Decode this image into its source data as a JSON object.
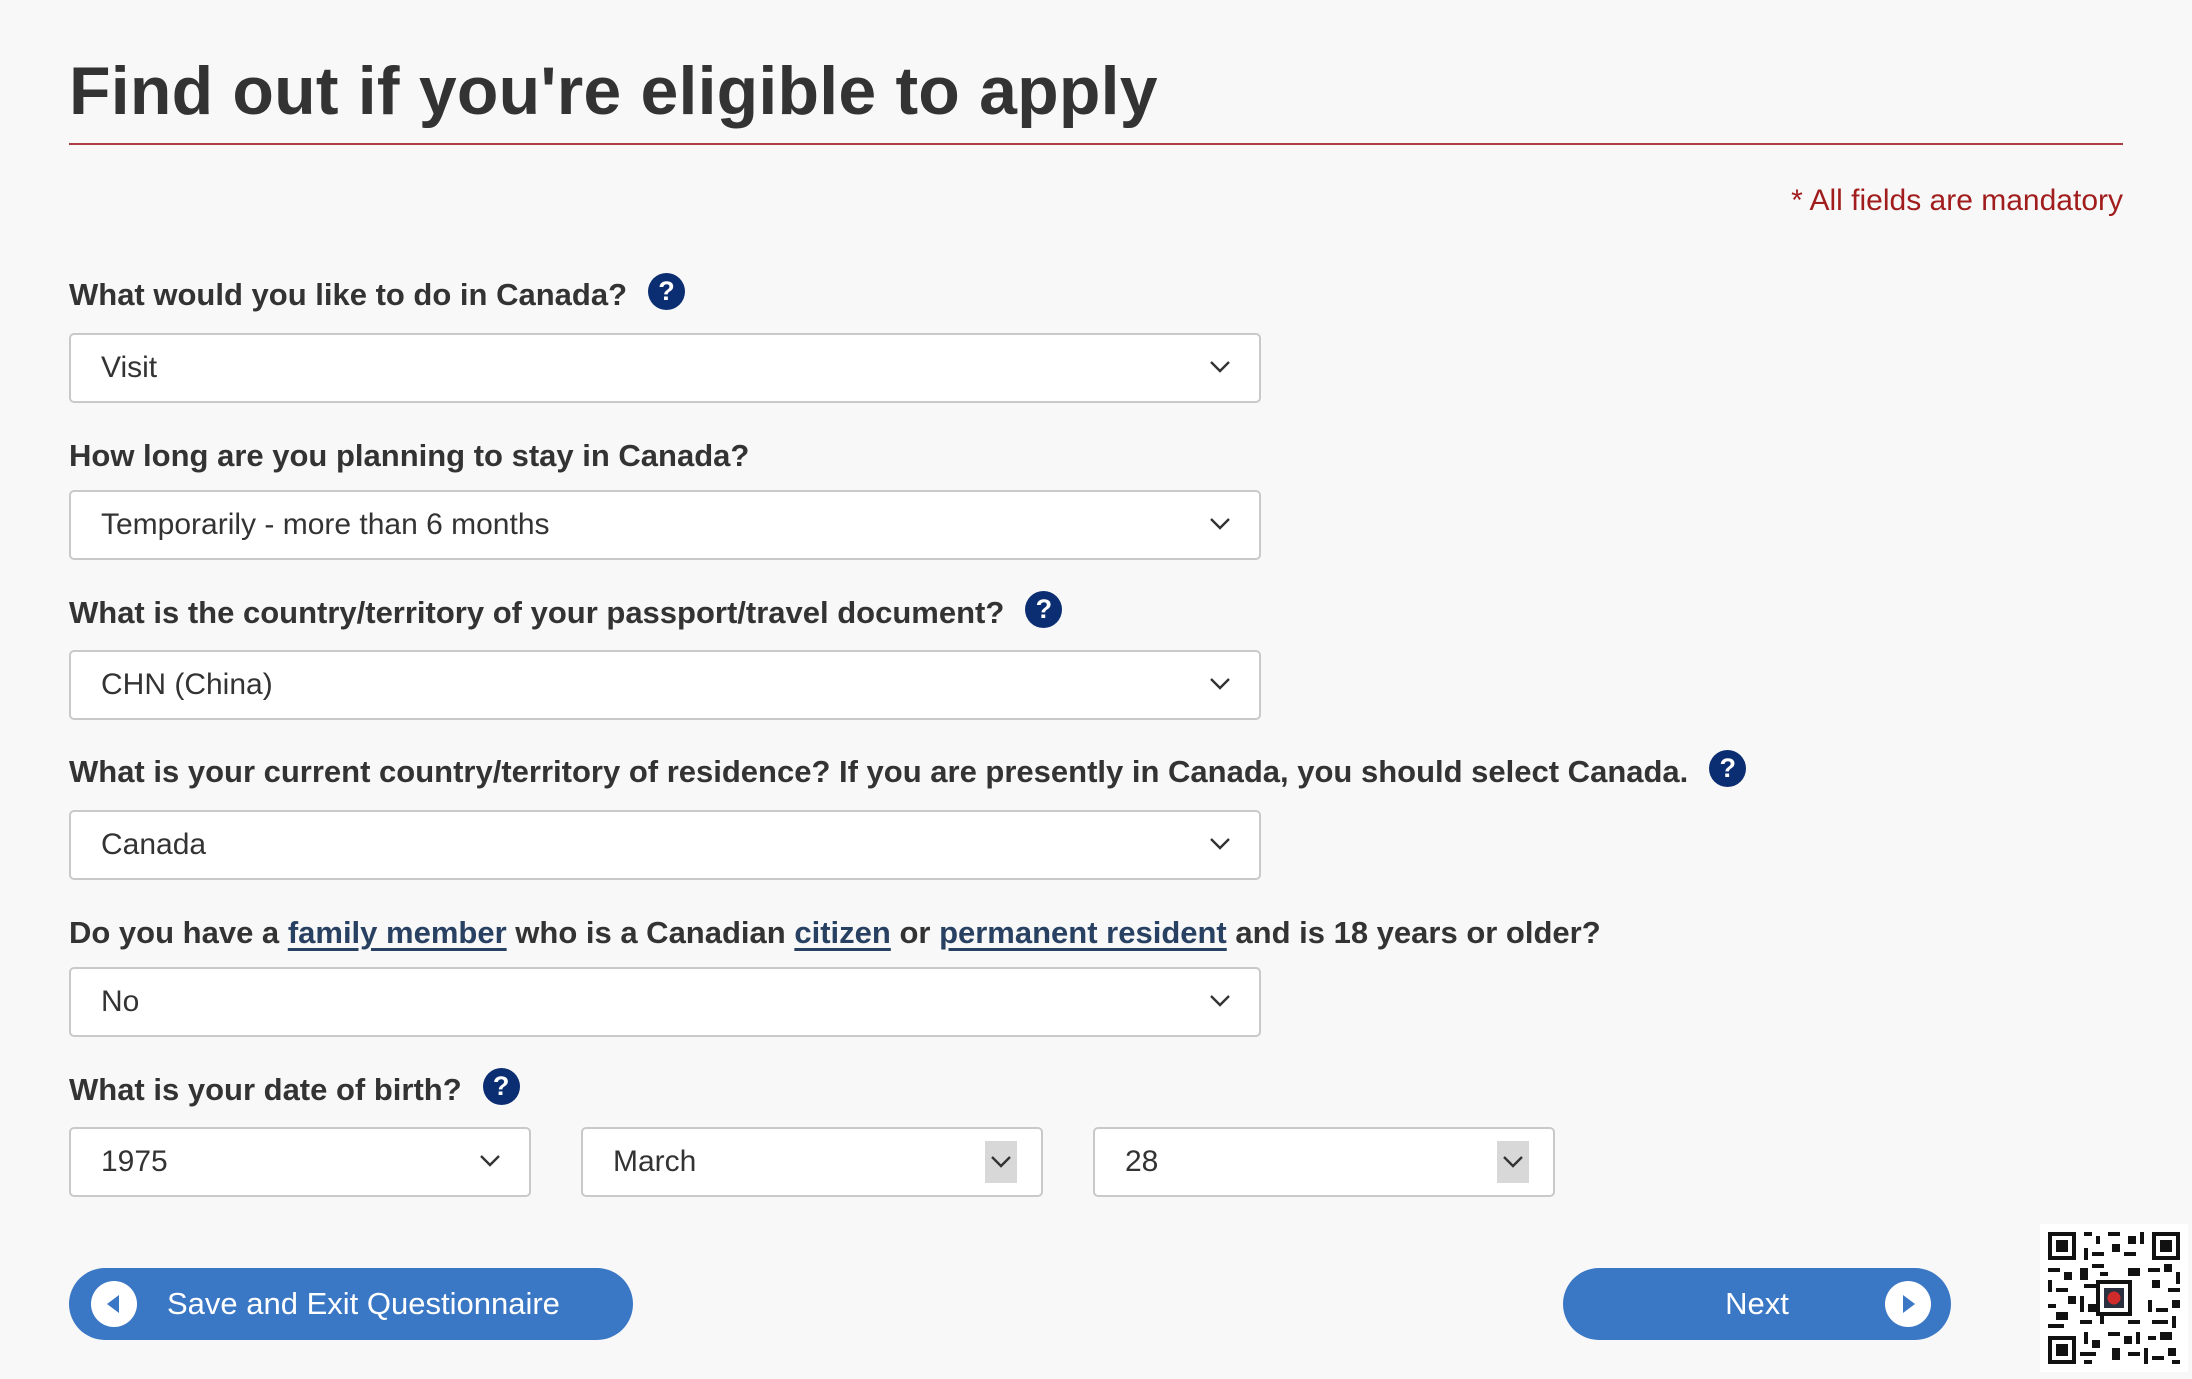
{
  "page": {
    "title": "Find out if you're eligible to apply",
    "mandatory_note": "* All fields are mandatory"
  },
  "questions": {
    "q1": {
      "label": "What would you like to do in Canada?",
      "value": "Visit"
    },
    "q2": {
      "label": "How long are you planning to stay in Canada?",
      "value": "Temporarily - more than 6 months"
    },
    "q3": {
      "label": "What is the country/territory of your passport/travel document?",
      "value": "CHN (China)"
    },
    "q4": {
      "label": "What is your current country/territory of residence? If you are presently in Canada, you should select Canada.",
      "value": "Canada"
    },
    "q5": {
      "part1": "Do you have a",
      "link1": "family member",
      "part2": "who is a Canadian",
      "link2": "citizen",
      "part3": "or",
      "link3": "permanent resident",
      "part4": "and is 18 years or older?",
      "value": "No"
    },
    "q6": {
      "label": "What is your date of birth?",
      "year": "1975",
      "month": "March",
      "day": "28"
    }
  },
  "help_glyph": "?",
  "buttons": {
    "save_exit": "Save and Exit Questionnaire",
    "next": "Next"
  },
  "colors": {
    "accent_rule": "#af3c43",
    "mandatory_text": "#a11d1d",
    "button_blue": "#3a77c5",
    "help_icon": "#0b2d71",
    "link": "#284162"
  },
  "icons": [
    "help-icon",
    "chevron-down-icon",
    "arrow-left-circle-icon",
    "arrow-right-circle-icon",
    "qr-code"
  ]
}
